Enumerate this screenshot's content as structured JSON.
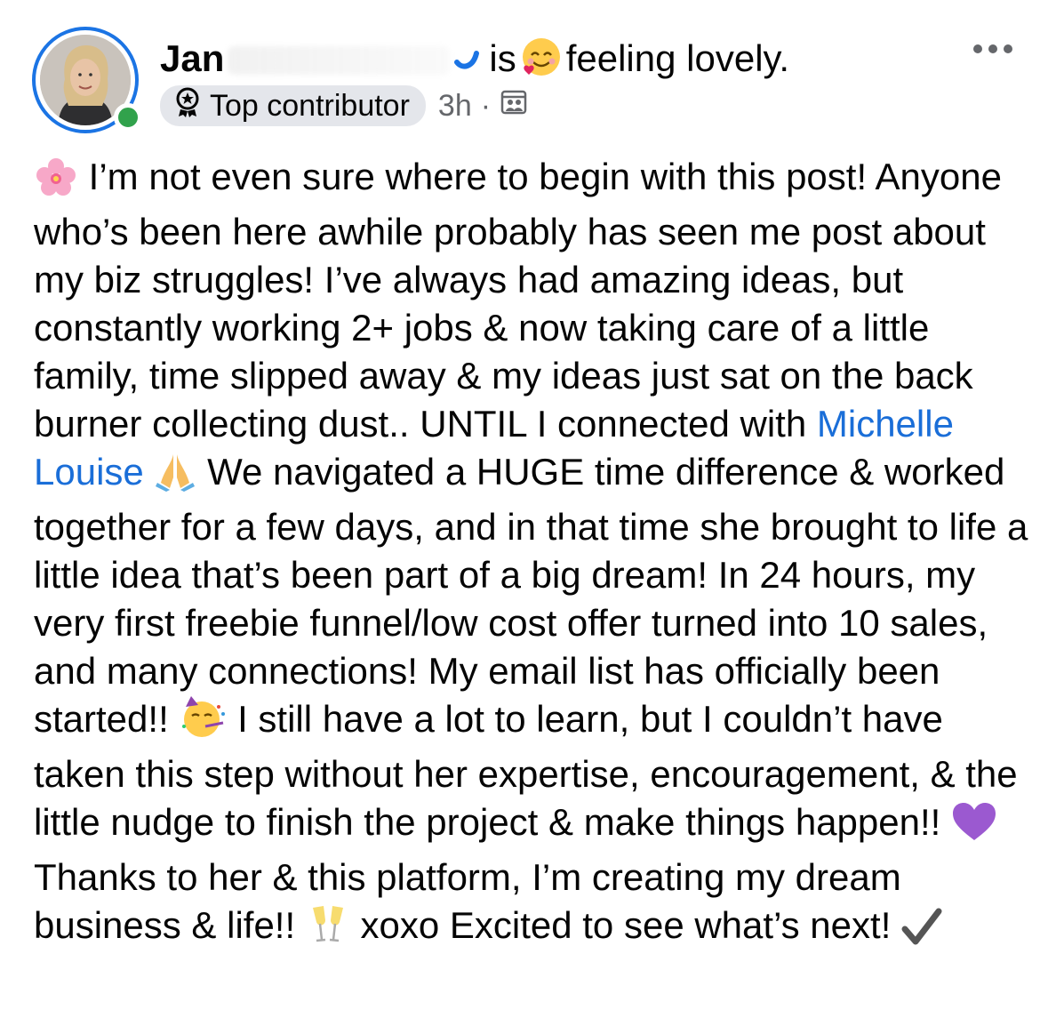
{
  "post": {
    "author": {
      "name_visible": "Jan",
      "avatar_icon": "user-avatar",
      "online": true
    },
    "activity": {
      "verb": "is",
      "emoji_icon": "smiling-face-with-hearts-icon",
      "feeling": "feeling lovely."
    },
    "badge": {
      "icon": "top-contributor-icon",
      "label": "Top contributor"
    },
    "time": "3h",
    "separator": "·",
    "audience_icon": "group-audience-icon",
    "more_icon": "more-options-icon",
    "body": {
      "p1": "I’m not even sure where to begin with this post! Anyone who’s been here awhile probably has seen me post about my biz struggles! I’ve always had amazing ideas, but constantly working 2+ jobs & now taking care of a little family, time slipped away & my ideas just sat on the back burner collecting dust.. UNTIL I connected with ",
      "mention": "Michelle Louise",
      "p2": " We navigated a HUGE time difference & worked together for a few days, and in that time she brought to life a little idea that’s been part of a big dream! In 24 hours, my very first freebie funnel/low cost offer turned into 10 sales, and many connections! My email list has officially been started!! ",
      "p3": " I still have a lot to learn, but I couldn’t have taken this step without her expertise, encouragement, & the little nudge to finish the project & make things happen!! ",
      "p4": " Thanks to her & this platform, I’m creating my dream business & life!! ",
      "p5": " xoxo Excited to see what’s next! "
    },
    "colors": {
      "accent": "#1b74e4",
      "mention": "#1a6ed8",
      "online": "#31a24c",
      "meta": "#65676b",
      "badge_bg": "#e4e6eb"
    }
  }
}
